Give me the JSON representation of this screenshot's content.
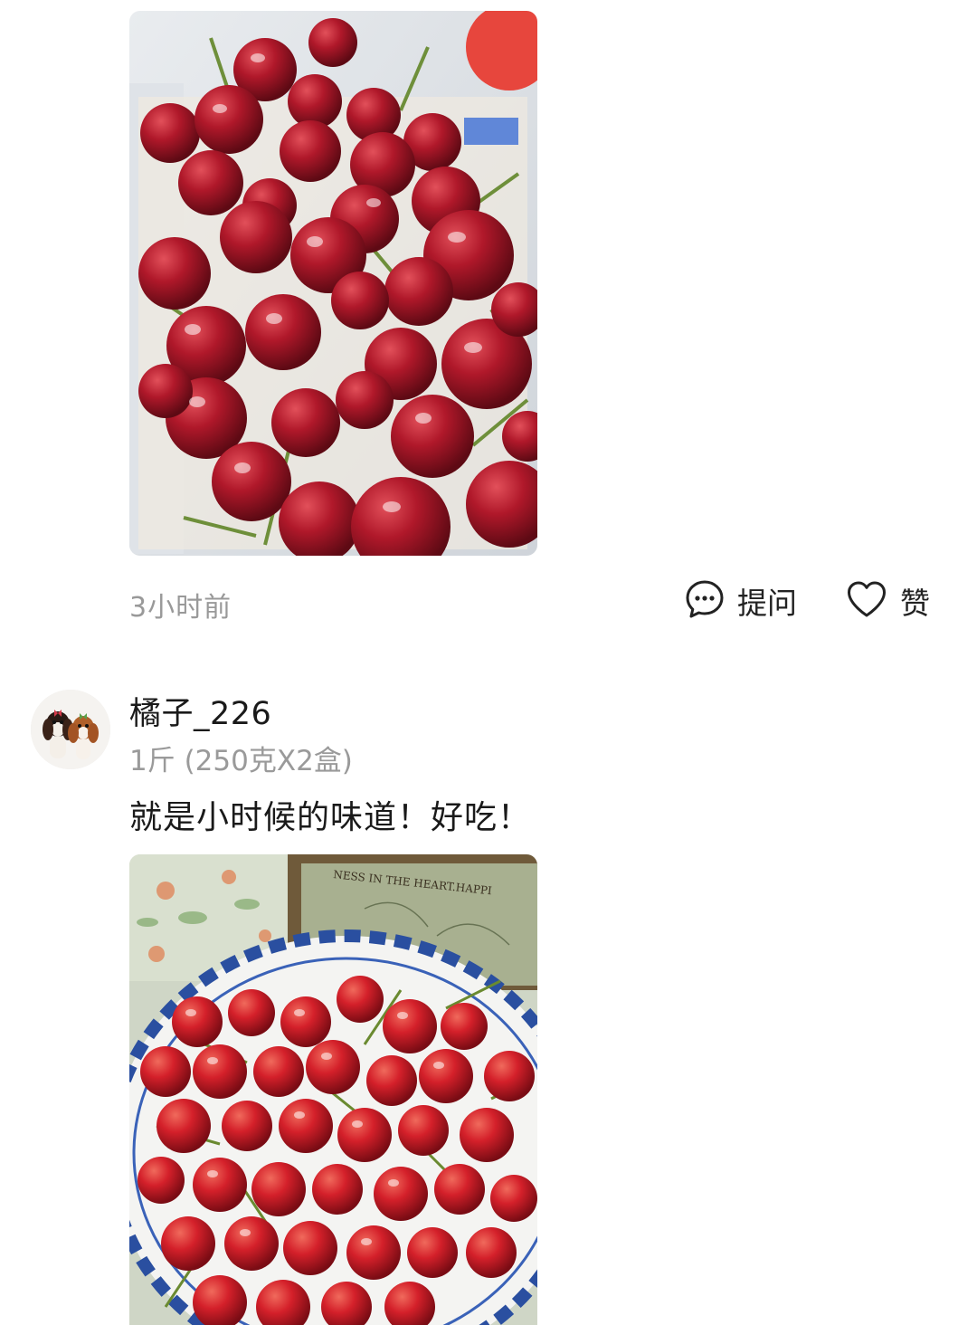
{
  "review_top": {
    "timestamp": "3小时前",
    "ask_label": "提问",
    "like_label": "赞"
  },
  "review_second": {
    "username": "橘子_226",
    "spec": "1斤 (250克X2盒)",
    "text": "就是小时候的味道！好吃！"
  },
  "photo_2_text": "NESS IN THE HEART.HAPPI",
  "icons": {
    "ask": "speech-bubble-icon",
    "like": "heart-outline-icon"
  },
  "colors": {
    "text_primary": "#1a1a1a",
    "text_secondary": "#999999",
    "background": "#ffffff"
  }
}
